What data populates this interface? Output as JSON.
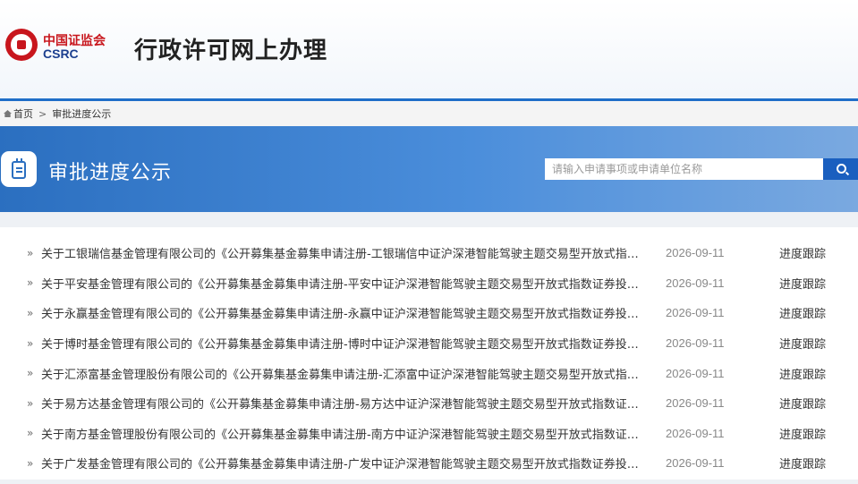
{
  "header": {
    "brand_cn": "中国证监会",
    "brand_en": "CSRC",
    "site_title": "行政许可网上办理"
  },
  "breadcrumb": {
    "home": "首页",
    "separator": ">",
    "current": "审批进度公示"
  },
  "banner": {
    "title": "审批进度公示",
    "search_placeholder": "请输入申请事项或申请单位名称"
  },
  "colors": {
    "accent": "#1f6ec8",
    "banner_start": "#2b6fc0",
    "brand_red": "#c8161d"
  },
  "list": {
    "items": [
      {
        "title": "关于工银瑞信基金管理有限公司的《公开募集基金募集申请注册-工银瑞信中证沪深港智能驾驶主题交易型开放式指数证券投资基金》",
        "date": "2026-09-11",
        "action": "进度跟踪"
      },
      {
        "title": "关于平安基金管理有限公司的《公开募集基金募集申请注册-平安中证沪深港智能驾驶主题交易型开放式指数证券投资基金》",
        "date": "2026-09-11",
        "action": "进度跟踪"
      },
      {
        "title": "关于永赢基金管理有限公司的《公开募集基金募集申请注册-永赢中证沪深港智能驾驶主题交易型开放式指数证券投资基金》",
        "date": "2026-09-11",
        "action": "进度跟踪"
      },
      {
        "title": "关于博时基金管理有限公司的《公开募集基金募集申请注册-博时中证沪深港智能驾驶主题交易型开放式指数证券投资基金》",
        "date": "2026-09-11",
        "action": "进度跟踪"
      },
      {
        "title": "关于汇添富基金管理股份有限公司的《公开募集基金募集申请注册-汇添富中证沪深港智能驾驶主题交易型开放式指数证券投资基金》",
        "date": "2026-09-11",
        "action": "进度跟踪"
      },
      {
        "title": "关于易方达基金管理有限公司的《公开募集基金募集申请注册-易方达中证沪深港智能驾驶主题交易型开放式指数证券投资基金》",
        "date": "2026-09-11",
        "action": "进度跟踪"
      },
      {
        "title": "关于南方基金管理股份有限公司的《公开募集基金募集申请注册-南方中证沪深港智能驾驶主题交易型开放式指数证券投资基金》",
        "date": "2026-09-11",
        "action": "进度跟踪"
      },
      {
        "title": "关于广发基金管理有限公司的《公开募集基金募集申请注册-广发中证沪深港智能驾驶主题交易型开放式指数证券投资基金》",
        "date": "2026-09-11",
        "action": "进度跟踪"
      }
    ]
  }
}
